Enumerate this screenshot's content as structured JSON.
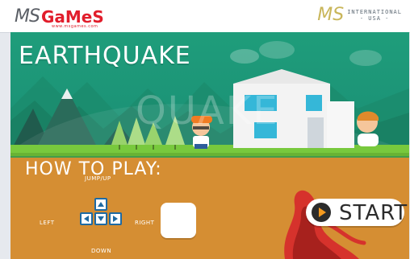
{
  "header": {
    "left_brand": {
      "ms": "MS",
      "games": "GaMeS",
      "tagline": "www.msgames.com"
    },
    "right_brand": {
      "ms": "MS",
      "line1": "INTERNATIONAL",
      "line2": "- USA -"
    }
  },
  "game": {
    "title": "EARTHQUAKE",
    "ghost_title": "QUAKE",
    "how_to_play": "HOW TO PLAY:",
    "controls": {
      "jump_label": "JUMP/UP",
      "left_label": "LEFT",
      "right_label": "RIGHT",
      "down_label": "DOWN"
    },
    "start_label": "START"
  },
  "colors": {
    "sky_green": "#1f9d7b",
    "grass": "#78c93d",
    "house": "#f3f3f3",
    "window": "#35b7d8",
    "lava": "#d6322c",
    "start_orange": "#f59a1e"
  }
}
